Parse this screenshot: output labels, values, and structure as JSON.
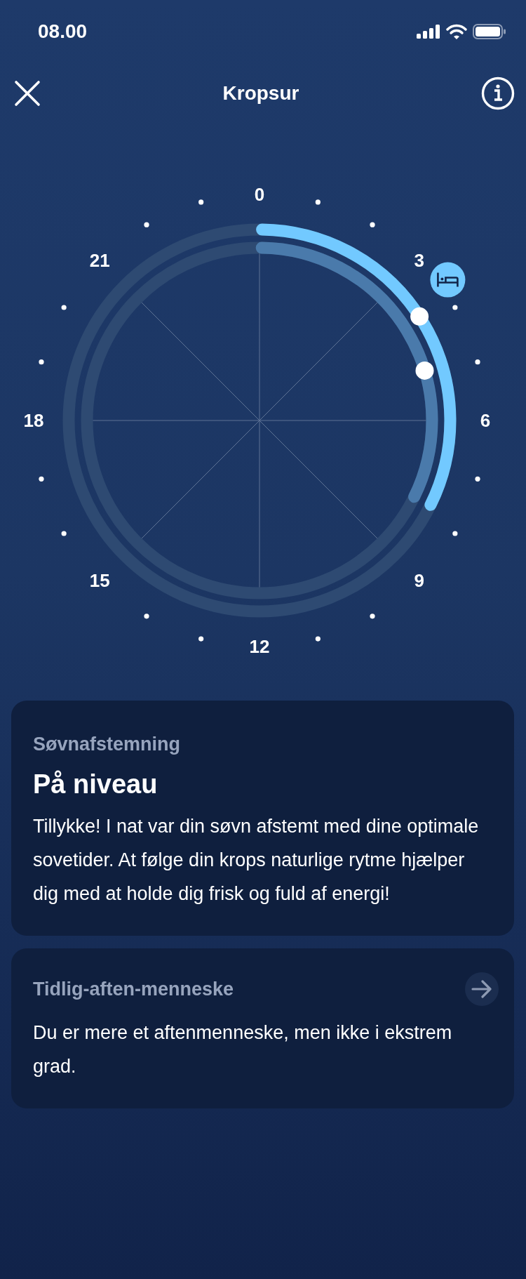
{
  "status_bar": {
    "time": "08.00"
  },
  "header": {
    "title": "Kropsur"
  },
  "clock": {
    "hour_labels": [
      "0",
      "3",
      "6",
      "9",
      "12",
      "15",
      "18",
      "21"
    ]
  },
  "cards": [
    {
      "kind": "result",
      "caption": "Søvnafstemning",
      "title": "På niveau",
      "text": "Tillykke! I nat var din søvn afstemt med dine optimale sovetider. At følge din krops naturlige rytme hjælper dig med at holde dig frisk og fuld af energi!"
    },
    {
      "kind": "link",
      "caption": "Tidlig-aften-menneske",
      "text": "Du er mere et aftenmenneske, men ikke i ekstrem grad."
    }
  ]
}
